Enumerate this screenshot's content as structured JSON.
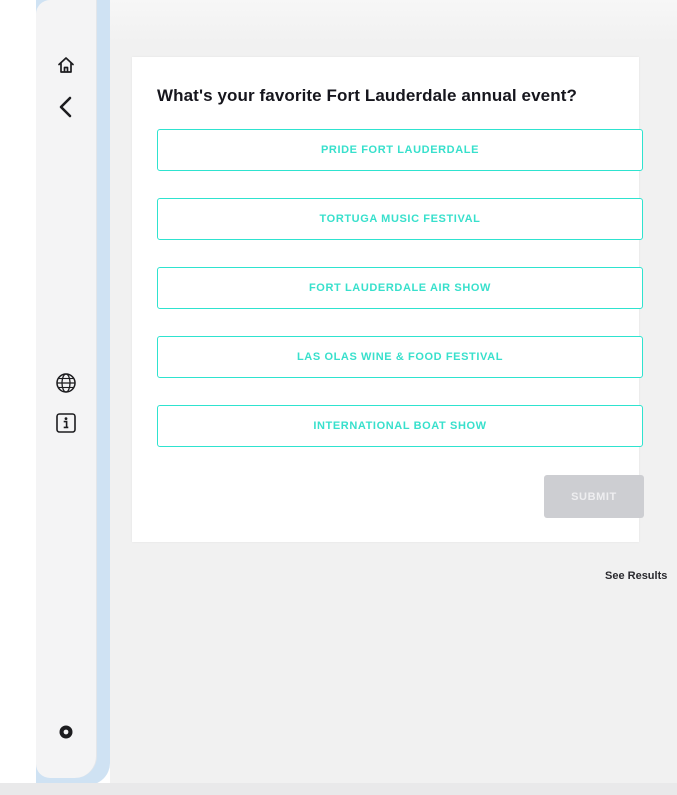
{
  "sidebar": {
    "home_icon": "home-icon",
    "back_icon": "chevron-left-icon",
    "language_icon": "globe-icon",
    "info_icon": "info-icon",
    "bottom_icon": "record-icon"
  },
  "poll": {
    "question": "What's your favorite Fort Lauderdale annual event?",
    "options": [
      "PRIDE FORT LAUDERDALE",
      "TORTUGA MUSIC FESTIVAL",
      "FORT LAUDERDALE AIR SHOW",
      "LAS OLAS WINE & FOOD FESTIVAL",
      "INTERNATIONAL BOAT SHOW"
    ],
    "submit_label": "SUBMIT",
    "see_results_label": "See Results"
  },
  "colors": {
    "accent": "#2ee3cf",
    "sidebar_rail": "#cfe2f3",
    "submit_disabled": "#cdced2"
  }
}
